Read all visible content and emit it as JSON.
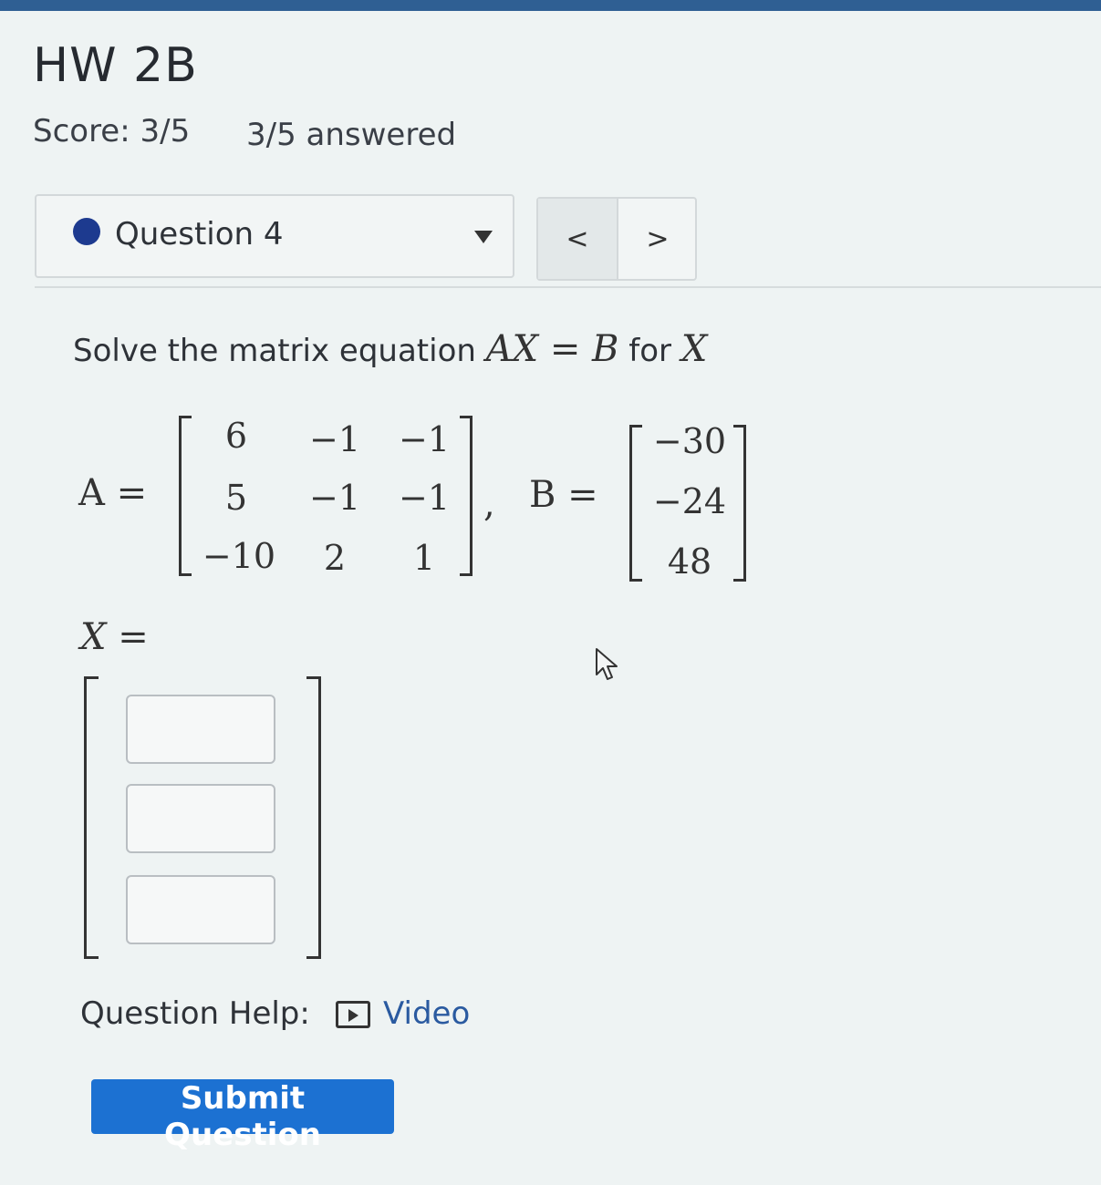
{
  "header": {
    "title": "HW 2B",
    "score": "Score: 3/5",
    "answered": "3/5 answered"
  },
  "question_nav": {
    "current": "Question 4",
    "prev_label": "<",
    "next_label": ">"
  },
  "problem": {
    "prompt_text": "Solve the matrix equation",
    "equation": "AX = B",
    "for_text": "for",
    "variable": "X",
    "matrix_A_label": "A =",
    "matrix_A": [
      [
        "6",
        "−1",
        "−1"
      ],
      [
        "5",
        "−1",
        "−1"
      ],
      [
        "−10",
        "2",
        "1"
      ]
    ],
    "matrix_B_label": "B =",
    "matrix_B": [
      "−30",
      "−24",
      "48"
    ],
    "answer_label": "X =",
    "answer_values": [
      "",
      "",
      ""
    ]
  },
  "help": {
    "label": "Question Help:",
    "video_icon": "video-play-icon",
    "video_label": "Video"
  },
  "actions": {
    "submit_label": "Submit Question"
  },
  "colors": {
    "topbar": "#2f5f93",
    "submit": "#1c71d2",
    "question_dot": "#1d3a8f",
    "link": "#2a5aa0"
  }
}
